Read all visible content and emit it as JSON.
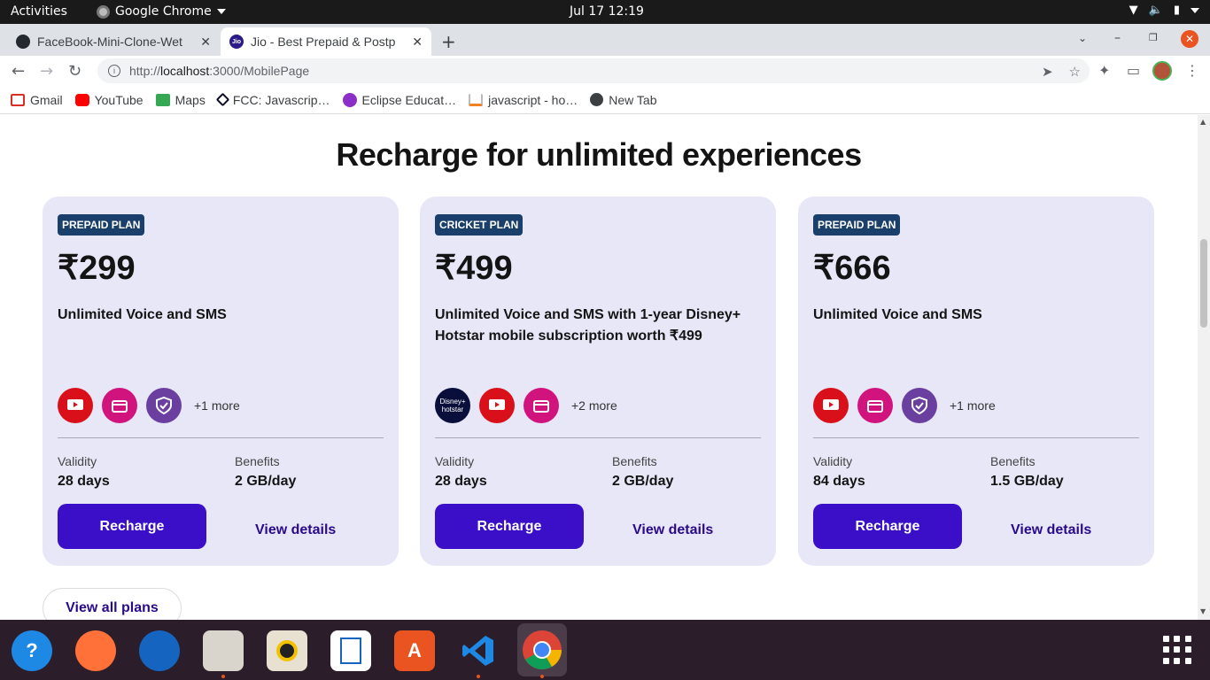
{
  "system": {
    "activities": "Activities",
    "app_name": "Google Chrome",
    "clock": "Jul 17  12:19"
  },
  "browser": {
    "tabs": [
      {
        "title": "FaceBook-Mini-Clone-Wet",
        "favicon": "github-icon"
      },
      {
        "title": "Jio - Best Prepaid & Postp",
        "favicon": "jio-icon"
      }
    ],
    "url": {
      "scheme": "http://",
      "host": "localhost",
      "rest": ":3000/MobilePage"
    },
    "bookmarks": [
      {
        "label": "Gmail",
        "icon": "gmail-icon",
        "color": "#d93025"
      },
      {
        "label": "YouTube",
        "icon": "youtube-icon",
        "color": "#ff0000"
      },
      {
        "label": "Maps",
        "icon": "maps-icon",
        "color": "#34a853"
      },
      {
        "label": "FCC: Javascrip…",
        "icon": "fcc-icon",
        "color": "#0a0a23"
      },
      {
        "label": "Eclipse Educat…",
        "icon": "eclipse-icon",
        "color": "#8b2fc9"
      },
      {
        "label": "javascript - ho…",
        "icon": "stackoverflow-icon",
        "color": "#f48024"
      },
      {
        "label": "New Tab",
        "icon": "globe-icon",
        "color": "#3c4043"
      }
    ]
  },
  "page": {
    "heading": "Recharge for unlimited experiences",
    "plans": [
      {
        "badge": "PREPAID PLAN",
        "price": "₹299",
        "description": "Unlimited Voice and SMS",
        "apps": [
          "youtube",
          "jiocinema",
          "jiosecurity"
        ],
        "more": "+1 more",
        "validity_label": "Validity",
        "validity": "28 days",
        "benefits_label": "Benefits",
        "benefits": "2 GB/day",
        "recharge": "Recharge",
        "details": "View details"
      },
      {
        "badge": "CRICKET PLAN",
        "price": "₹499",
        "description": "Unlimited Voice and SMS with 1-year Disney+ Hotstar mobile subscription worth ₹499",
        "apps": [
          "hotstar",
          "youtube",
          "jiocinema"
        ],
        "more": "+2 more",
        "validity_label": "Validity",
        "validity": "28 days",
        "benefits_label": "Benefits",
        "benefits": "2 GB/day",
        "recharge": "Recharge",
        "details": "View details"
      },
      {
        "badge": "PREPAID PLAN",
        "price": "₹666",
        "description": "Unlimited Voice and SMS",
        "apps": [
          "youtube",
          "jiocinema",
          "jiosecurity"
        ],
        "more": "+1 more",
        "validity_label": "Validity",
        "validity": "84 days",
        "benefits_label": "Benefits",
        "benefits": "1.5 GB/day",
        "recharge": "Recharge",
        "details": "View details"
      }
    ],
    "view_all": "View all plans",
    "hotstar_logo_text": "Disney+ hotstar"
  },
  "colors": {
    "card_bg": "#e8e7f7",
    "badge_bg": "#1a3f6b",
    "recharge_bg": "#3a0fc7",
    "link": "#2a0a8a"
  }
}
